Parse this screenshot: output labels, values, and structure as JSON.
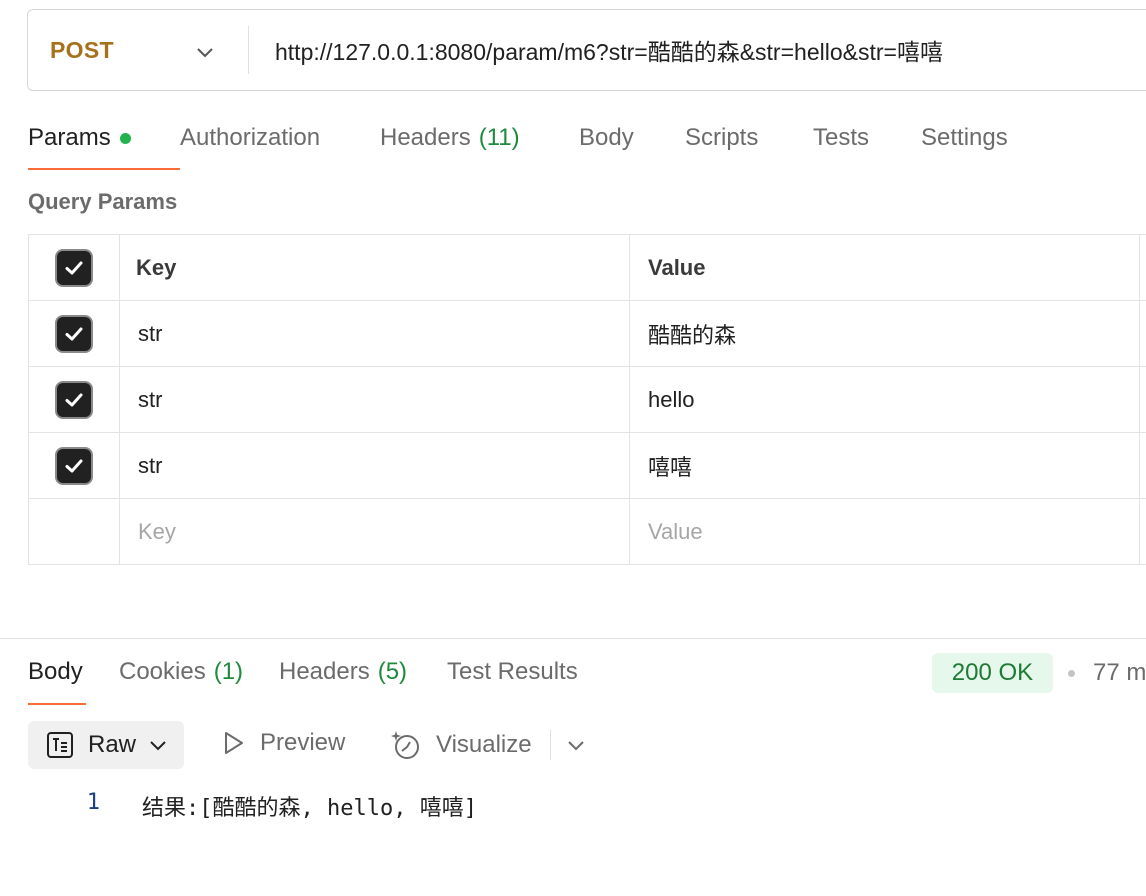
{
  "request": {
    "method": "POST",
    "url": "http://127.0.0.1:8080/param/m6?str=酷酷的森&str=hello&str=嘻嘻"
  },
  "request_tabs": [
    {
      "label": "Params",
      "count": "",
      "active": true,
      "dot": true
    },
    {
      "label": "Authorization",
      "count": ""
    },
    {
      "label": "Headers",
      "count": "(11)"
    },
    {
      "label": "Body",
      "count": ""
    },
    {
      "label": "Scripts",
      "count": ""
    },
    {
      "label": "Tests",
      "count": ""
    },
    {
      "label": "Settings",
      "count": ""
    }
  ],
  "query_params": {
    "title": "Query Params",
    "header": {
      "key": "Key",
      "value": "Value"
    },
    "rows": [
      {
        "key": "str",
        "value": "酷酷的森",
        "checked": true
      },
      {
        "key": "str",
        "value": "hello",
        "checked": true
      },
      {
        "key": "str",
        "value": "嘻嘻",
        "checked": true
      }
    ],
    "placeholder": {
      "key": "Key",
      "value": "Value"
    }
  },
  "response_tabs": [
    {
      "label": "Body",
      "count": "",
      "active": true
    },
    {
      "label": "Cookies",
      "count": "(1)"
    },
    {
      "label": "Headers",
      "count": "(5)"
    },
    {
      "label": "Test Results",
      "count": ""
    }
  ],
  "response": {
    "status": "200 OK",
    "time": "77 m"
  },
  "view_toolbar": {
    "raw": "Raw",
    "preview": "Preview",
    "visualize": "Visualize"
  },
  "body_lines": [
    {
      "no": "1",
      "text": "结果:[酷酷的森, hello, 嘻嘻]"
    }
  ],
  "colors": {
    "method": "#a7711b",
    "accent": "#ff6c37",
    "count": "#1f8a3c",
    "status_bg": "#e6f7ec",
    "status_text": "#1f7a34"
  }
}
